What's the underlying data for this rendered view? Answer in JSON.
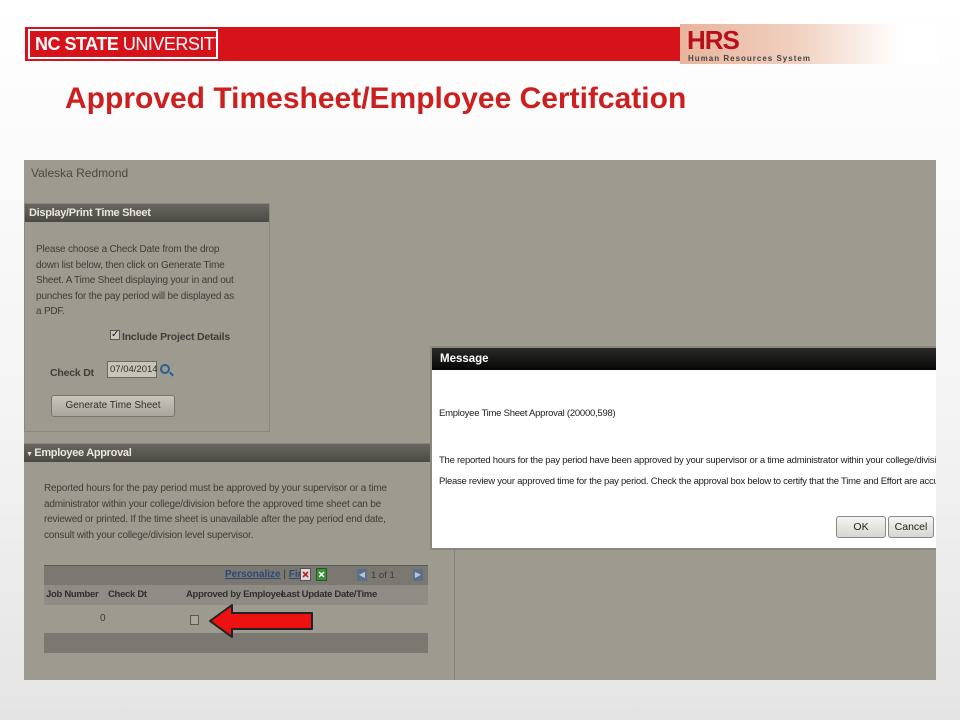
{
  "slide": {
    "title": "Approved Timesheet/Employee Certifcation",
    "ncsu_logo_bold": "NC STATE",
    "ncsu_logo_light": "UNIVERSITY",
    "hrs_logo": "HRS",
    "hrs_subtitle": "Human Resources System"
  },
  "app": {
    "user_name": "Valeska Redmond",
    "display_panel": {
      "title": "Display/Print Time Sheet",
      "instructions": "Please choose a Check Date from the drop down list below, then click on Generate Time Sheet. A Time Sheet displaying your in and out punches for the pay period will be displayed as a PDF.",
      "include_project_details_label": "Include Project Details",
      "include_project_details_checked": true,
      "check_dt_label": "Check Dt",
      "check_dt_value": "07/04/2014",
      "generate_button": "Generate Time Sheet"
    },
    "approval_panel": {
      "title": "Employee Approval",
      "instructions": "Reported hours for the pay period must be approved by your supervisor or a time administrator within your college/division before the approved time sheet can be reviewed or printed. If the time sheet is unavailable after the pay period end date, consult with your college/division level supervisor.",
      "grid": {
        "personalize": "Personalize",
        "find": "Find",
        "separator": "|",
        "pager": "1 of 1",
        "columns": [
          "Job Number",
          "Check Dt",
          "Approved by Employee",
          "Last Update Date/Time"
        ],
        "rows": [
          {
            "job_number": "0",
            "check_dt": "",
            "approved": false,
            "last_update": ""
          }
        ]
      }
    }
  },
  "dialog": {
    "title": "Message",
    "line1": "Employee Time Sheet Approval (20000,598)",
    "line2": "The reported hours for the pay period have been approved by your supervisor or a time administrator within your college/division.",
    "line3": "Please review your approved time for the pay period.  Check the approval box below to certify that the Time and Effort are accurate.",
    "ok": "OK",
    "cancel": "Cancel"
  },
  "colors": {
    "brand_red": "#d6131b",
    "title_red": "#cc1f1f",
    "screen_overlay": "#9d9a8f",
    "arrow_red": "#ee1111"
  }
}
